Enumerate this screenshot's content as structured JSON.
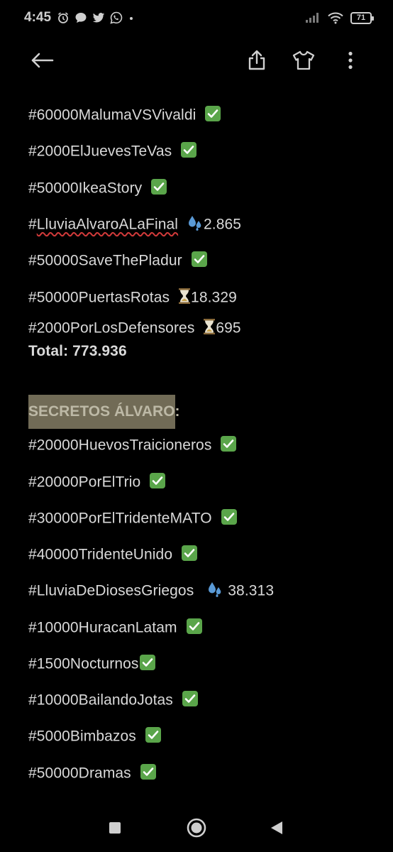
{
  "status_bar": {
    "time": "4:45",
    "left_icons": [
      "alarm-icon",
      "chat-bubble-icon",
      "twitter-icon",
      "whatsapp-icon",
      "dot-icon"
    ],
    "battery": "71"
  },
  "toolbar": {
    "icons": [
      "back-arrow-icon",
      "share-icon",
      "tshirt-icon",
      "more-vert-icon"
    ]
  },
  "content": {
    "lines": [
      {
        "text": "#60000MalumaVSVivaldi",
        "status": "check"
      },
      {
        "text": "#2000ElJuevesTeVas",
        "status": "check"
      },
      {
        "text": "#50000IkeaStory",
        "status": "check"
      },
      {
        "prefix": "#",
        "underlined": "LluviaAlvaroALaFinal",
        "status": "droplets",
        "count": "2.865"
      },
      {
        "text": "#50000SaveThePladur",
        "status": "check"
      },
      {
        "text": "#50000PuertasRotas",
        "status": "hourglass",
        "count": "18.329"
      },
      {
        "text": "#2000PorLosDefensores",
        "status": "hourglass",
        "count": "695"
      }
    ],
    "total": "Total: 773.936",
    "section_title": "SECRETOS ÁLVARO:",
    "secret_lines": [
      {
        "text": "#20000HuevosTraicioneros",
        "status": "check"
      },
      {
        "text": "#20000PorElTrio",
        "status": "check"
      },
      {
        "text": "#30000PorElTridenteMATO",
        "status": "check"
      },
      {
        "text": "#40000TridenteUnido",
        "status": "check"
      },
      {
        "text": "#LluviaDeDiosesGriegos",
        "status": "droplets",
        "count": "38.313"
      },
      {
        "text": "#10000HuracanLatam",
        "status": "check"
      },
      {
        "text": "#1500Nocturnos",
        "status": "check"
      },
      {
        "text": "#10000BailandoJotas",
        "status": "check"
      },
      {
        "text": "#5000Bimbazos",
        "status": "check"
      },
      {
        "text": "#50000Dramas",
        "status": "check"
      }
    ]
  },
  "nav_bar": {
    "icons": [
      "recents-square-icon",
      "home-circle-icon",
      "back-triangle-icon"
    ]
  },
  "colors": {
    "background": "#000000",
    "text": "#d9d9d9",
    "check_green": "#5aa54a",
    "highlight": "#716b56",
    "droplet_blue": "#5a9ad6",
    "hourglass": "#c8a24a"
  }
}
